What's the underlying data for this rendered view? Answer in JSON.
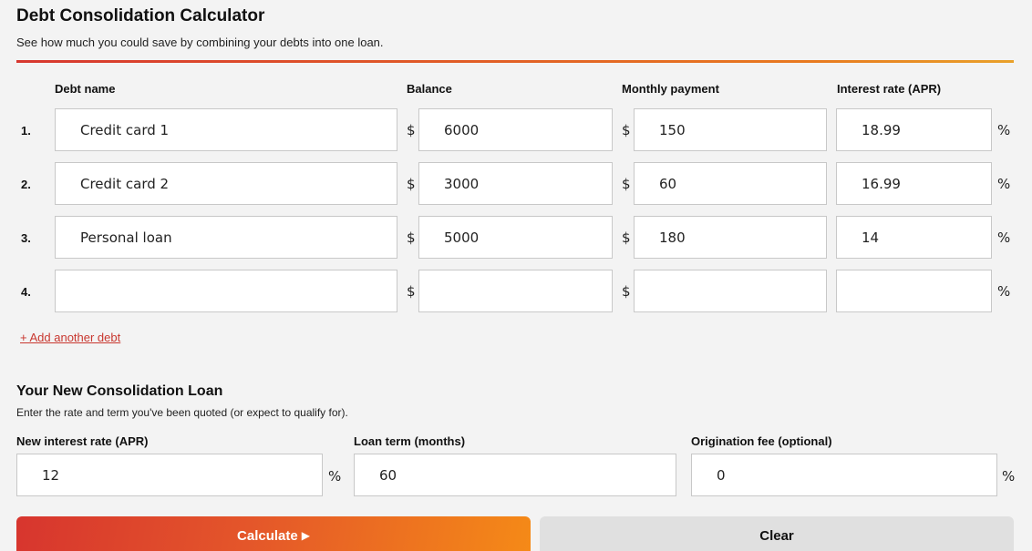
{
  "header": {
    "title": "Debt Consolidation Calculator",
    "subtitle": "See how much you could save by combining your debts into one loan."
  },
  "debts_table": {
    "columns": {
      "name": "Debt name",
      "balance": "Balance",
      "payment": "Monthly payment",
      "rate": "Interest rate (APR)"
    },
    "currency_symbol": "$",
    "percent_symbol": "%",
    "rows": [
      {
        "num": "1.",
        "name": "Credit card 1",
        "balance": "6000",
        "payment": "150",
        "rate": "18.99"
      },
      {
        "num": "2.",
        "name": "Credit card 2",
        "balance": "3000",
        "payment": "60",
        "rate": "16.99"
      },
      {
        "num": "3.",
        "name": "Personal loan",
        "balance": "5000",
        "payment": "180",
        "rate": "14"
      },
      {
        "num": "4.",
        "name": "",
        "balance": "",
        "payment": "",
        "rate": ""
      }
    ],
    "add_link": "+ Add another debt"
  },
  "new_loan": {
    "title": "Your New Consolidation Loan",
    "subtitle": "Enter the rate and term you've been quoted (or expect to qualify for).",
    "rate_label": "New interest rate (APR)",
    "rate_value": "12",
    "term_label": "Loan term (months)",
    "term_value": "60",
    "fee_label": "Origination fee (optional)",
    "fee_value": "0",
    "percent_symbol": "%"
  },
  "actions": {
    "calculate_label": "Calculate",
    "calculate_icon": "▶",
    "clear_label": "Clear"
  },
  "colors": {
    "accent_start": "#d7372f",
    "accent_end": "#f58a17",
    "link": "#c8372f"
  }
}
